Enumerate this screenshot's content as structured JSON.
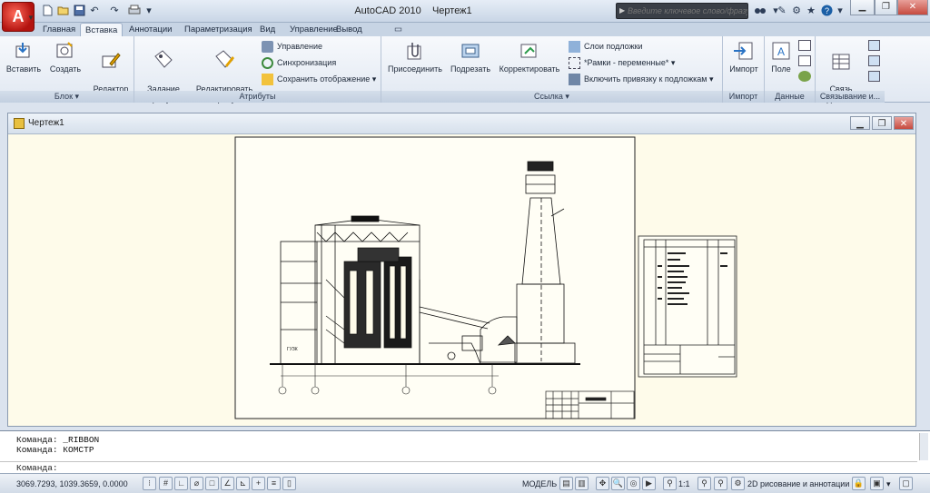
{
  "app": {
    "title": "AutoCAD 2010",
    "doc": "Чертеж1",
    "logo_letter": "A",
    "search_placeholder": "Введите ключевое слово/фразу"
  },
  "quick_access": {
    "icons": [
      "new-file-icon",
      "open-folder-icon",
      "save-icon",
      "undo-icon",
      "redo-icon",
      "plot-icon",
      "dropdown-arrow-icon"
    ]
  },
  "title_tools": [
    "binoculars-icon",
    "wrench-icon",
    "communication-center-icon",
    "favorites-star-icon",
    "help-icon"
  ],
  "tabs": [
    "Главная",
    "Вставка",
    "Аннотации",
    "Параметризация",
    "Вид",
    "Управление",
    "Вывод"
  ],
  "active_tab": "Вставка",
  "ribbon": {
    "block": {
      "label": "Блок",
      "buttons": [
        "Вставить",
        "Создать",
        "Редактор\nблоков"
      ]
    },
    "attributes": {
      "label": "Атрибуты",
      "big": [
        "Задание\nатрибутов",
        "Редактировать\nатрибут"
      ],
      "small": [
        "Управление",
        "Синхронизация",
        "Сохранить отображение"
      ]
    },
    "reference": {
      "label": "Ссылка",
      "big": [
        "Присоединить",
        "Подрезать",
        "Корректировать"
      ],
      "small": [
        "Слои подложки",
        "*Рамки - переменные*",
        "Включить привязку к подложкам"
      ]
    },
    "import": {
      "label": "Импорт",
      "button": "Импорт"
    },
    "data": {
      "label": "Данные",
      "button": "Поле"
    },
    "link": {
      "label": "Связывание и...",
      "button": "Связь\nс данными"
    }
  },
  "drawing": {
    "tab_title": "Чертеж1",
    "room_label": "ГУЗК"
  },
  "command": {
    "line1": "Команда: _RIBBON",
    "line2": "Команда: КОМСТР",
    "prompt": "Команда:"
  },
  "status": {
    "coords": "3069.7293, 1039.3659, 0.0000",
    "model": "МОДЕЛЬ",
    "scale": "1:1",
    "workspace": "2D рисование и аннотации"
  },
  "colors": {
    "accent": "#1b5fa6",
    "canvas": "#fefbea"
  }
}
